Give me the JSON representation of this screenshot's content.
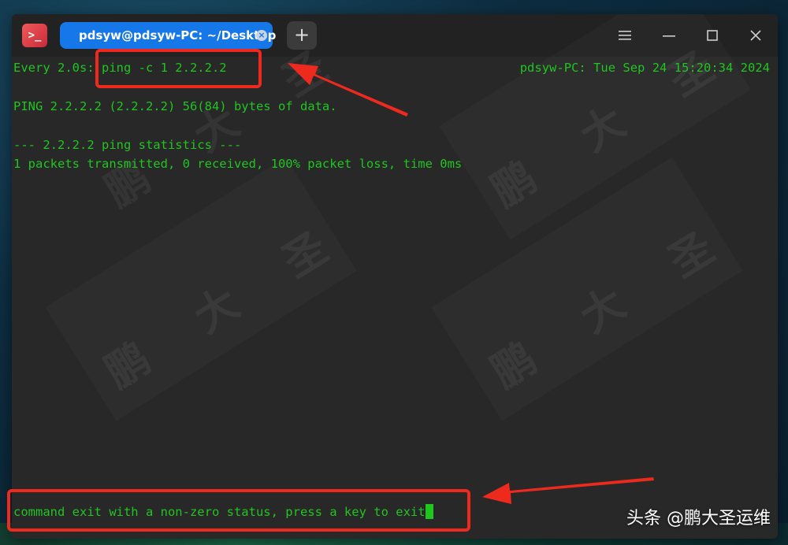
{
  "window": {
    "app_icon": "terminal-icon",
    "tab_title": "pdsyw@pdsyw-PC: ~/Desktop",
    "tab_close_icon": "×",
    "new_tab_icon": "+",
    "menu_icon": "☰",
    "minimize_icon": "—",
    "maximize_icon": "☐",
    "close_icon": "✕"
  },
  "terminal": {
    "header_left": "Every 2.0s: ping -c 1 2.2.2.2",
    "header_right": "pdsyw-PC: Tue Sep 24 15:20:34 2024",
    "lines": [
      "PING 2.2.2.2 (2.2.2.2) 56(84) bytes of data.",
      "",
      "--- 2.2.2.2 ping statistics ---",
      "1 packets transmitted, 0 received, 100% packet loss, time 0ms"
    ],
    "exit_message": "command exit with a non-zero status, press a key to exit"
  },
  "watermark": "鹏 大 圣",
  "brand": "头条 @鹏大圣运维",
  "colors": {
    "terminal_bg": "#282828",
    "text_green": "#1fc61f",
    "tab_blue": "#1677e8",
    "highlight_red": "#ee2a1e"
  }
}
